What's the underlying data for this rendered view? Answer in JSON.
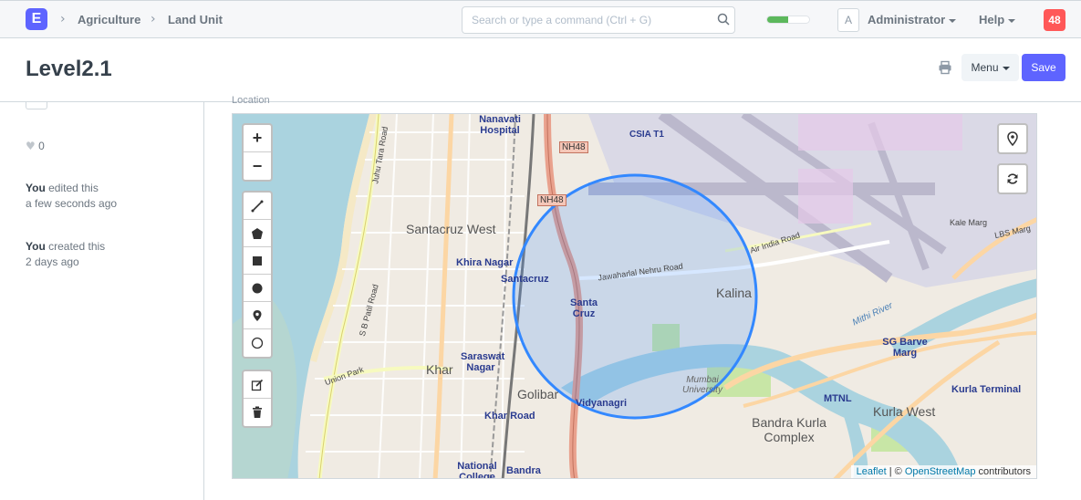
{
  "navbar": {
    "logo_letter": "E",
    "breadcrumbs": [
      "Agriculture",
      "Land Unit"
    ],
    "search_placeholder": "Search or type a command (Ctrl + G)",
    "progress_fraction": 0.5,
    "avatar_letter": "A",
    "user_label": "Administrator",
    "help_label": "Help",
    "notification_count": "48"
  },
  "page": {
    "title": "Level2.1",
    "menu_label": "Menu",
    "save_label": "Save"
  },
  "sidebar": {
    "like_count": "0",
    "activity": [
      {
        "who": "You",
        "action": "edited this",
        "when": "a few seconds ago"
      },
      {
        "who": "You",
        "action": "created this",
        "when": "2 days ago"
      }
    ]
  },
  "form": {
    "location_label": "Location"
  },
  "map": {
    "labels": {
      "santacruz_west": "Santacruz West",
      "khira_nagar": "Khira Nagar",
      "santacruz": "Santacruz",
      "santa_cruz": "Santa Cruz",
      "saraswat_nagar": "Saraswat Nagar",
      "khar": "Khar",
      "golibar": "Golibar",
      "vidyanagri": "Vidyanagri",
      "kalina": "Kalina",
      "mumbai_university": "Mumbai University",
      "bandra_kurla_complex": "Bandra Kurla Complex",
      "kurla_west": "Kurla West",
      "kurla_terminal": "Kurla Terminal",
      "sg_barve_marg": "SG Barve Marg",
      "mtnl": "MTNL",
      "csia_t1": "CSIA T1",
      "nh48_a": "NH48",
      "nh48_b": "NH48",
      "nanavati_hospital": "Nanavati Hospital",
      "jawaharlal_nehru_road": "Jawaharlal Nehru Road",
      "air_india_road": "Air India Road",
      "lbs_marg": "LBS Marg",
      "kale_marg": "Kale Marg",
      "mithi_river": "Mithi River",
      "national_college": "National College",
      "bandra": "Bandra",
      "khar_road": "Khar Road",
      "union_park": "Union Park",
      "juhu_tara_road": "Juhu Tara Road",
      "s_v_road": "S B Patil Road"
    },
    "attribution": {
      "leaflet": "Leaflet",
      "separator": " | © ",
      "osm": "OpenStreetMap",
      "suffix": " contributors"
    }
  },
  "colors": {
    "brand": "#5e64ff",
    "notification": "#ff5858",
    "progress": "#5cb85c",
    "circle_stroke": "#3388ff"
  }
}
